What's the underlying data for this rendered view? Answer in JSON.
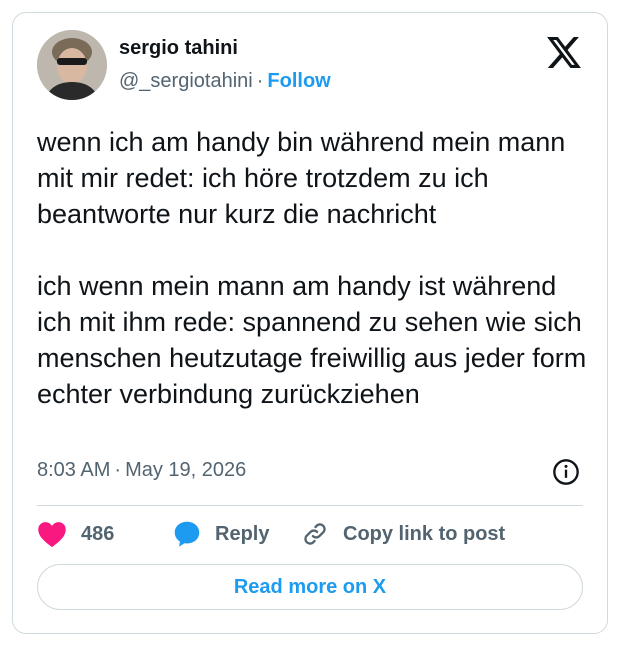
{
  "author": {
    "name": "sergio tahini",
    "handle": "@_sergiotahini",
    "separator": "·",
    "follow_label": "Follow",
    "avatar_icon": "profile-photo"
  },
  "tweet": {
    "paragraphs": [
      "wenn ich am handy bin während mein mann mit mir redet: ich höre trotzdem zu ich beantworte nur kurz die nachricht",
      "ich wenn mein mann am handy ist während ich mit ihm rede: spannend zu sehen wie sich menschen heutzutage freiwillig aus jeder form echter verbindung zurückziehen"
    ],
    "time": "8:03 AM",
    "separator": "·",
    "date": "May 19, 2026"
  },
  "actions": {
    "like_count": "486",
    "reply_label": "Reply",
    "copy_link_label": "Copy link to post"
  },
  "read_more_label": "Read more on X",
  "icons": {
    "brand": "x-logo-icon",
    "info": "info-icon",
    "like": "heart-icon",
    "reply": "reply-bubble-icon",
    "copy": "link-icon"
  },
  "colors": {
    "accent": "#1d9bf0",
    "like": "#f91880",
    "text": "#0f1419",
    "muted": "#536471",
    "border": "#cfd9de"
  }
}
